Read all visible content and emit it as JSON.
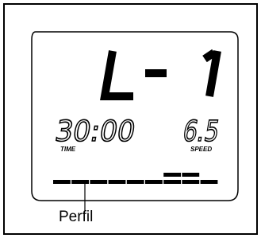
{
  "display": {
    "program_text": "L - 1",
    "time_value": "30:00",
    "time_label": "TIME",
    "speed_value": "6.5",
    "speed_label": "SPEED"
  },
  "profile": {
    "label": "Perfil",
    "levels": [
      1,
      1,
      1,
      1,
      1,
      1,
      2,
      2,
      1
    ]
  }
}
